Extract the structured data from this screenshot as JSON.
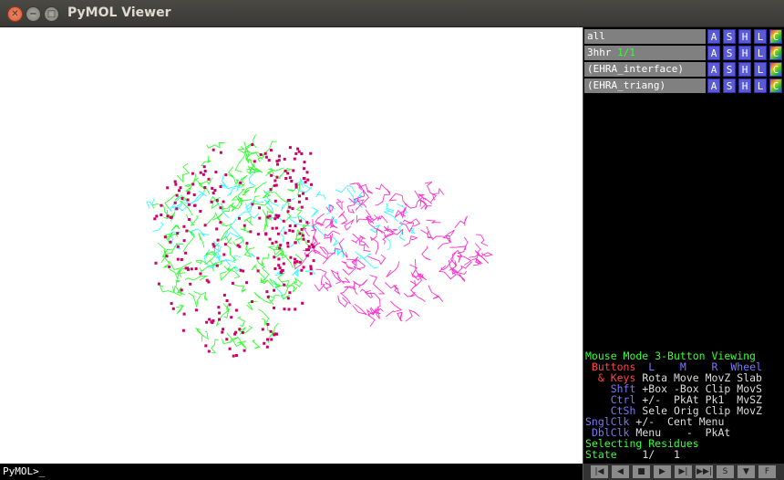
{
  "window": {
    "title": "PyMOL Viewer"
  },
  "command": {
    "prompt": "PyMOL>_"
  },
  "objects": [
    {
      "name": "all",
      "state": ""
    },
    {
      "name": "3hhr",
      "state": "1/1"
    },
    {
      "name": "(EHRA_interface)",
      "state": ""
    },
    {
      "name": "(EHRA_triang)",
      "state": ""
    }
  ],
  "object_buttons": [
    "A",
    "S",
    "H",
    "L",
    "C"
  ],
  "mouse": {
    "mode_label": "Mouse Mode",
    "mode_value": "3-Button Viewing",
    "buttons_label": "Buttons",
    "col_l": "L",
    "col_m": "M",
    "col_r": "R",
    "col_wheel": "Wheel",
    "rows": [
      {
        "key": "& Keys",
        "l": "Rota",
        "m": "Move",
        "r": "MovZ",
        "w": "Slab"
      },
      {
        "key": "Shft",
        "l": "+Box",
        "m": "-Box",
        "r": "Clip",
        "w": "MovS"
      },
      {
        "key": "Ctrl",
        "l": "+/-",
        "m": "PkAt",
        "r": "Pk1",
        "w": "MvSZ"
      },
      {
        "key": "CtSh",
        "l": "Sele",
        "m": "Orig",
        "r": "Clip",
        "w": "MovZ"
      }
    ],
    "sngl_label": "SnglClk",
    "sngl": {
      "l": "+/-",
      "m": "Cent",
      "r": "Menu"
    },
    "dbl_label": "DblClk",
    "dbl": {
      "l": "Menu",
      "m": "-",
      "r": "PkAt"
    },
    "selecting": "Selecting Residues",
    "state_label": "State",
    "state_value": "1/",
    "state_total": "1"
  },
  "vcr_buttons": [
    "|◀",
    "◀",
    "■",
    "▶",
    "▶|",
    "▶▶|",
    "S",
    "▼",
    "F"
  ],
  "colors": {
    "green": "#33ff33",
    "magenta": "#ff33cc",
    "cyan": "#33ffff",
    "atoms": "#cc0066"
  }
}
